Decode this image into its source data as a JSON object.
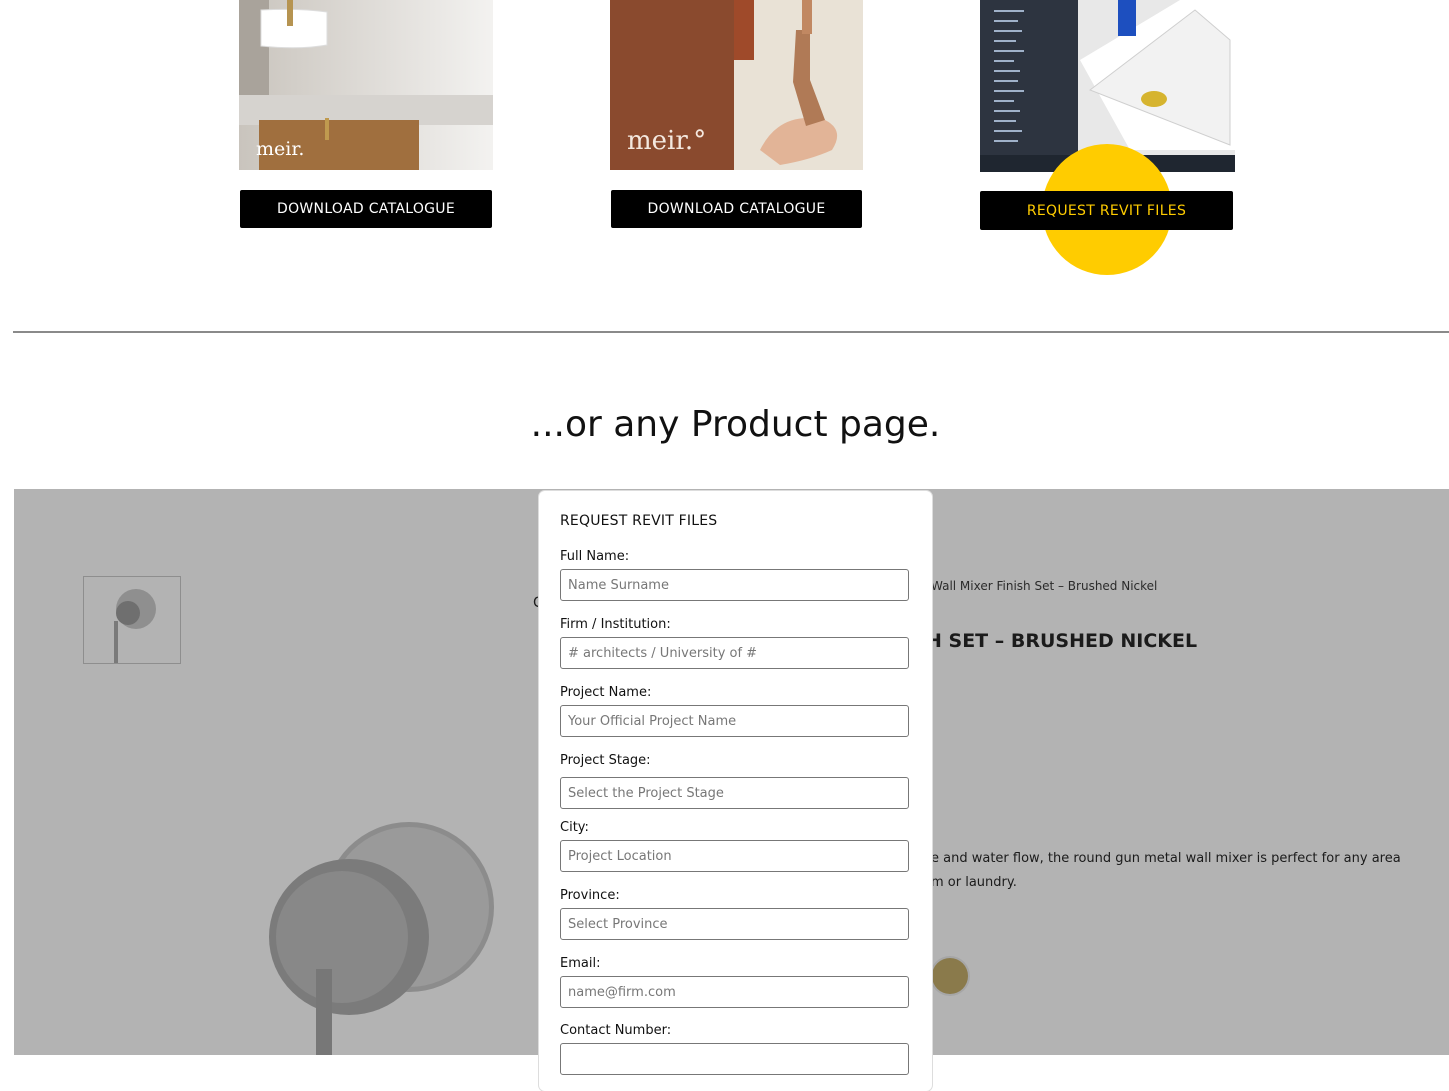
{
  "cards": [
    {
      "button_label": "DOWNLOAD CATALOGUE",
      "brand_text": "meir."
    },
    {
      "button_label": "DOWNLOAD CATALOGUE",
      "brand_text": "meir.°"
    },
    {
      "button_label": "REQUEST REVIT FILES"
    }
  ],
  "section_heading": "...or any Product page.",
  "product_preview": {
    "breadcrumb": "Wall Mixer Finish Set – Brushed Nickel",
    "title_fragment": "H SET – BRUSHED NICKEL",
    "desc_line_1": "e and water flow, the round gun metal wall mixer is perfect for any area",
    "desc_line_2": "m or laundry.",
    "finish_color": "#8a7a4b"
  },
  "modal": {
    "title": "REQUEST REVIT FILES",
    "fields": [
      {
        "label": "Full Name:",
        "placeholder": "Name Surname"
      },
      {
        "label": "Firm / Institution:",
        "placeholder": "# architects / University of #"
      },
      {
        "label": "Project Name:",
        "placeholder": "Your Official Project Name"
      },
      {
        "label": "Project Stage:",
        "placeholder": "Select the Project Stage"
      },
      {
        "label": "City:",
        "placeholder": "Project Location"
      },
      {
        "label": "Province:",
        "placeholder": "Select Province"
      },
      {
        "label": "Email:",
        "placeholder": "name@firm.com"
      },
      {
        "label": "Contact Number:",
        "placeholder": ""
      }
    ]
  },
  "colors": {
    "highlight": "#ffcc00",
    "button_bg": "#000000",
    "overlay": "#b3b3b3"
  }
}
